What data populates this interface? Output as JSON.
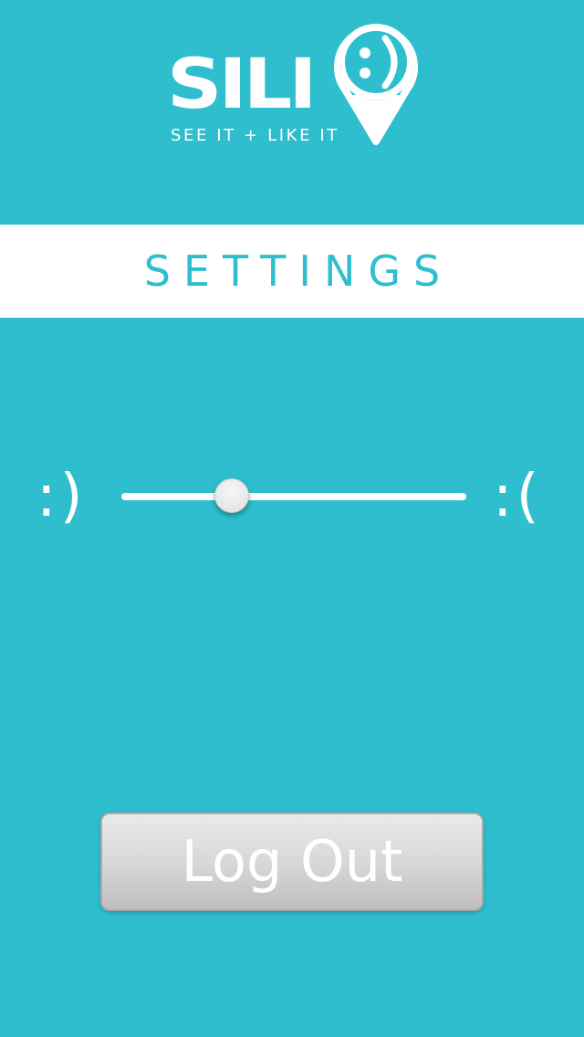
{
  "logo": {
    "wordmark": "SILI",
    "tagline": "SEE IT + LIKE IT",
    "pin_icon": "map-pin-smiley-icon"
  },
  "header": {
    "title": "SETTINGS"
  },
  "slider": {
    "left_label": ":)",
    "right_label": ":(",
    "value": 0.32
  },
  "logout": {
    "label": "Log Out"
  },
  "colors": {
    "background": "#2EBECE",
    "header_background": "#FFFFFF",
    "accent": "#2EBECE",
    "button_text": "#FFFFFF"
  }
}
